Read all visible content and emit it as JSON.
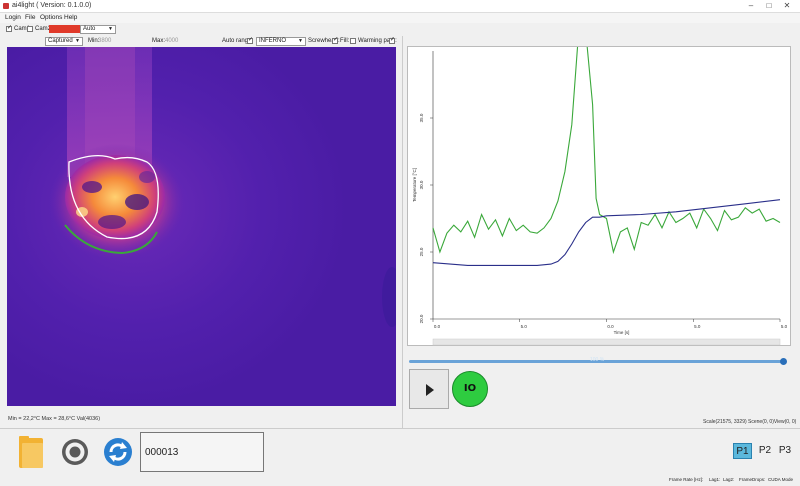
{
  "window": {
    "title": "ai4light ( Version: 0.1.0.0)",
    "minimize": "–",
    "maximize": "□",
    "close": "✕"
  },
  "menu": [
    "Login",
    "File",
    "Options",
    "Help"
  ],
  "camrow": {
    "cam1": "Cam1",
    "cam2": "Cam2",
    "mode_value": "Auto"
  },
  "toolbar": {
    "source_value": "Captured",
    "min_label": "Min:",
    "min_value": "3800",
    "max_label": "Max:",
    "max_value": "4000",
    "autorange_label": "Auto range:",
    "palette_value": "INFERNO",
    "screwhead_label": "Screwhead:",
    "fill_label": "Fill:",
    "warming_label": "Warming path:"
  },
  "left_status": "Min = 22,2°C Max = 28,6°C Val(4036)",
  "right_status": "Scale(21575, 3329) Scene(0, 0)View(0, 0)",
  "frame_counter": "000013",
  "io_label": "IO",
  "slider": {
    "value": 1.0,
    "label": "100 %"
  },
  "profiles": [
    "P1",
    "P2",
    "P3"
  ],
  "footer": {
    "framerate": "Frame Rate [Hz]:",
    "lag1": "Lag1:",
    "lag2": "Lag2:",
    "framedrops": "FrameDrops:",
    "mode": "CUDA Mode"
  },
  "colors": {
    "green_series": "#3aa83a",
    "blue_series": "#2a2f8a",
    "io_green": "#2ecc40",
    "thermal_bg": "#4a1ba6"
  },
  "chart_data": {
    "type": "line",
    "ylabel": "Temperature [°C]",
    "xlabel": "Time [s]",
    "yticks": [
      "20.0",
      "25.0",
      "30.0",
      "35.0"
    ],
    "xticks": [
      "0.0",
      "5.0",
      "0.0",
      "5.0",
      "5.0"
    ],
    "ylim": [
      20,
      40
    ],
    "xlim": [
      0,
      100
    ],
    "grid": false,
    "series": [
      {
        "color": "#3aa83a",
        "x": [
          0,
          2,
          4,
          6,
          8,
          10,
          12,
          14,
          16,
          18,
          20,
          22,
          24,
          26,
          28,
          30,
          32,
          34,
          36,
          38,
          40,
          42,
          44,
          46,
          47,
          48,
          50,
          52,
          54,
          56,
          58,
          60,
          62,
          64,
          66,
          68,
          70,
          72,
          74,
          76,
          78,
          80,
          82,
          84,
          86,
          88,
          90,
          92,
          94,
          96,
          98,
          100
        ],
        "y": [
          26.8,
          25.0,
          26.4,
          27.0,
          26.5,
          27.3,
          26.1,
          27.8,
          26.7,
          27.4,
          26.2,
          27.5,
          26.6,
          27.0,
          26.5,
          26.4,
          26.8,
          27.5,
          28.8,
          31.0,
          34.5,
          41.5,
          41.5,
          36.0,
          29.0,
          27.8,
          27.5,
          25.0,
          26.5,
          26.8,
          25.2,
          27.2,
          27.0,
          27.8,
          26.8,
          28.0,
          27.2,
          27.5,
          27.9,
          26.8,
          28.2,
          27.5,
          26.6,
          28.1,
          27.4,
          27.6,
          28.3,
          27.9,
          28.2,
          27.3,
          27.5,
          27.2
        ]
      },
      {
        "color": "#2a2f8a",
        "x": [
          0,
          10,
          20,
          30,
          34,
          36,
          38,
          40,
          42,
          44,
          46,
          48,
          50,
          60,
          70,
          80,
          90,
          100
        ],
        "y": [
          24.2,
          24.0,
          24.0,
          24.0,
          24.1,
          24.3,
          24.8,
          25.6,
          26.5,
          27.2,
          27.6,
          27.6,
          27.7,
          27.8,
          28.0,
          28.3,
          28.6,
          28.9
        ]
      }
    ]
  }
}
